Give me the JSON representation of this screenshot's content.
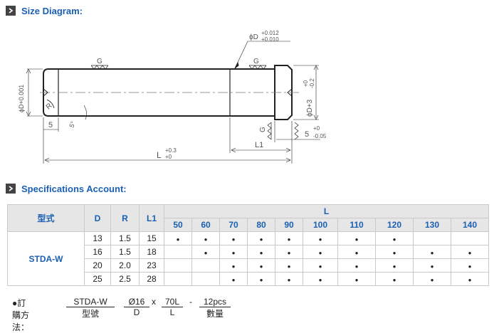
{
  "size_section": {
    "title": "Size Diagram:"
  },
  "spec_section": {
    "title": "Specifications Account:"
  },
  "diagram": {
    "g1": "G",
    "g2": "G",
    "g3": "G",
    "phi_d_tol_top": "+0.012",
    "phi_d_tol_bot": "+0.010",
    "phi_d": "ϕD",
    "left_dia": "ϕD+0.001",
    "head_dia": "ϕD+3",
    "head_dia_tol_top": "+0",
    "head_dia_tol_bot": "-0.2",
    "r_label": "R",
    "five_left": "5",
    "angle": "5°",
    "l1": "L1",
    "l": "L",
    "l_tol_top": "+0.3",
    "l_tol_bot": "+0",
    "head_h": "5",
    "head_h_tol_top": "+0",
    "head_h_tol_bot": "-0.05"
  },
  "table": {
    "col_model": "型式",
    "col_d": "D",
    "col_r": "R",
    "col_l1": "L1",
    "col_l": "L",
    "l_values": [
      "50",
      "60",
      "70",
      "80",
      "90",
      "100",
      "110",
      "120",
      "130",
      "140"
    ],
    "model_name": "STDA-W",
    "rows": [
      {
        "d": "13",
        "r": "1.5",
        "l1": "15",
        "avail": [
          true,
          true,
          true,
          true,
          true,
          true,
          true,
          true,
          false,
          false
        ]
      },
      {
        "d": "16",
        "r": "1.5",
        "l1": "18",
        "avail": [
          false,
          true,
          true,
          true,
          true,
          true,
          true,
          true,
          true,
          true
        ]
      },
      {
        "d": "20",
        "r": "2.0",
        "l1": "23",
        "avail": [
          false,
          false,
          true,
          true,
          true,
          true,
          true,
          true,
          true,
          true
        ]
      },
      {
        "d": "25",
        "r": "2.5",
        "l1": "28",
        "avail": [
          false,
          false,
          true,
          true,
          true,
          true,
          true,
          true,
          true,
          true
        ]
      }
    ]
  },
  "order": {
    "label": "●訂購方法：",
    "model_top": "STDA-W",
    "model_bot": "型號",
    "d_top": "Ø16",
    "d_bot": "D",
    "x_sep": "x",
    "l_top": "70L",
    "l_bot": "L",
    "dash_sep": "-",
    "qty_top": "12pcs",
    "qty_bot": "數量"
  }
}
